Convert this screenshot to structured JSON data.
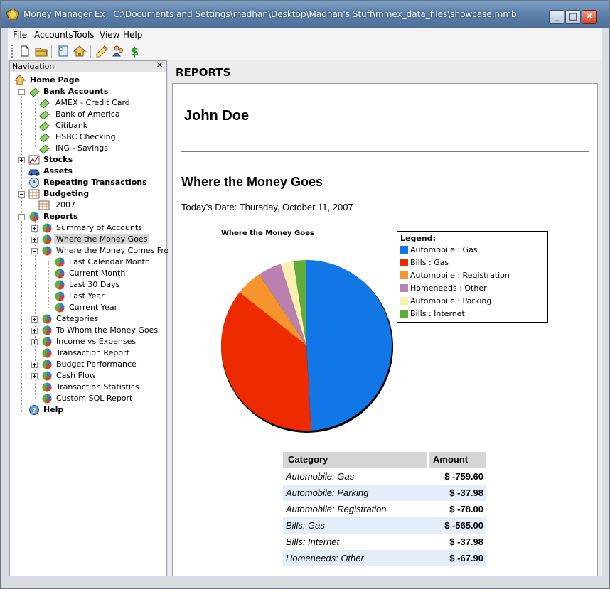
{
  "window": {
    "title": "Money Manager Ex : C:\\Documents and Settings\\madhan\\Desktop\\Madhan's Stuff\\mmex_data_files\\showcase.mmb"
  },
  "menu": [
    "File",
    "Accounts",
    "Tools",
    "View",
    "Help"
  ],
  "toolbar": {
    "icons": [
      "new-file-icon",
      "open-folder-icon",
      "new-account-icon",
      "home-icon",
      "organize-icon",
      "payees-icon",
      "currency-icon"
    ]
  },
  "navigation": {
    "title": "Navigation",
    "close_label": "✕",
    "home": "Home Page",
    "bank_accounts": {
      "label": "Bank Accounts",
      "items": [
        "AMEX - Credit Card",
        "Bank of America",
        "Citibank",
        "HSBC Checking",
        "ING - Savings"
      ]
    },
    "stocks": "Stocks",
    "assets": "Assets",
    "repeating": "Repeating Transactions",
    "budgeting": {
      "label": "Budgeting",
      "items": [
        "2007"
      ]
    },
    "reports": {
      "label": "Reports",
      "items": [
        "Summary of Accounts",
        "Where the Money Goes",
        "Where the Money Comes From",
        "Categories",
        "To Whom the Money Goes",
        "Income vs Expenses",
        "Transaction Report",
        "Budget Performance",
        "Cash Flow",
        "Transaction Statistics",
        "Custom SQL Report"
      ],
      "comes_from_items": [
        "Last Calendar Month",
        "Current Month",
        "Last 30 Days",
        "Last Year",
        "Current Year"
      ]
    },
    "help": "Help"
  },
  "report": {
    "heading": "REPORTS",
    "user": "John Doe",
    "section_title": "Where the Money Goes",
    "today_date": "Today's Date: Thursday, October 11, 2007",
    "legend_title": "Legend:",
    "table": {
      "headers": [
        "Category",
        "Amount"
      ],
      "rows": [
        {
          "category": "Automobile: Gas",
          "amount": "$ -759.60"
        },
        {
          "category": "Automobile: Parking",
          "amount": "$ -37.98"
        },
        {
          "category": "Automobile: Registration",
          "amount": "$ -78.00"
        },
        {
          "category": "Bills: Gas",
          "amount": "$ -565.00"
        },
        {
          "category": "Bills: Internet",
          "amount": "$ -37.98"
        },
        {
          "category": "Homeneeds: Other",
          "amount": "$ -67.90"
        }
      ]
    }
  },
  "chart_data": {
    "type": "pie",
    "title": "Where the Money Goes",
    "legend_position": "top-right",
    "categories": [
      "Automobile : Gas",
      "Bills : Gas",
      "Automobile : Registration",
      "Homeneeds : Other",
      "Automobile : Parking",
      "Bills : Internet"
    ],
    "values": [
      759.6,
      565.0,
      78.0,
      67.9,
      37.98,
      37.98
    ],
    "colors": [
      "#1176e6",
      "#ee2a00",
      "#f6952d",
      "#b980b0",
      "#fbf0b0",
      "#5fac3c"
    ]
  }
}
